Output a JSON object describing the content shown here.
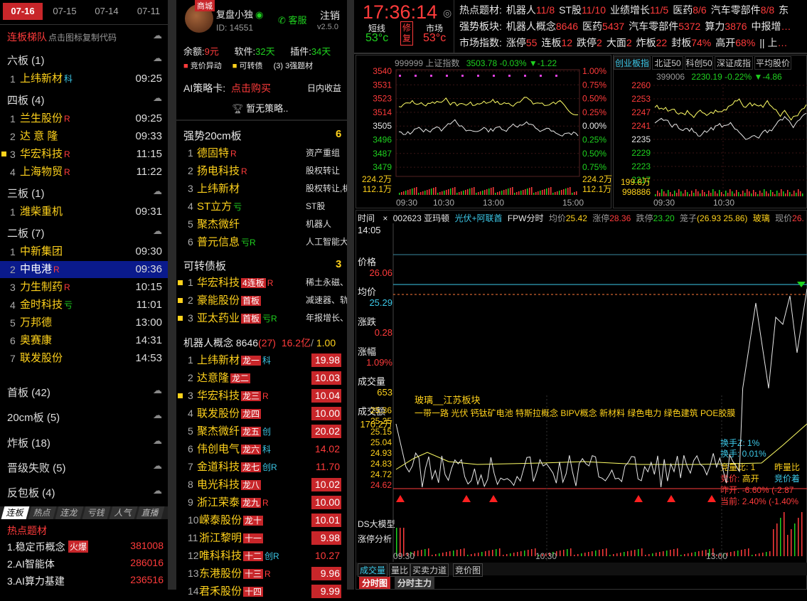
{
  "left": {
    "dates": [
      "07-16",
      "07-15",
      "07-14",
      "07-11"
    ],
    "header": {
      "title": "连板梯队",
      "hint": "点击图标复制代码"
    },
    "groups": [
      {
        "label": "六板  (1)",
        "rows": [
          {
            "n": "1",
            "name": "上纬新材",
            "tag": "科",
            "tagc": "cyan",
            "time": "09:25"
          }
        ]
      },
      {
        "label": "四板  (4)",
        "rows": [
          {
            "n": "1",
            "name": "兰生股份",
            "tag": "R",
            "tagc": "red",
            "time": "09:25"
          },
          {
            "n": "2",
            "name": "达 意 隆",
            "tag": "",
            "tagc": "",
            "time": "09:33"
          },
          {
            "n": "3",
            "name": "华宏科技",
            "tag": "R",
            "tagc": "red",
            "time": "11:15",
            "mark": true
          },
          {
            "n": "4",
            "name": "上海物贸",
            "tag": "R",
            "tagc": "red",
            "time": "11:22"
          }
        ]
      },
      {
        "label": "三板  (1)",
        "rows": [
          {
            "n": "1",
            "name": "潍柴重机",
            "tag": "",
            "tagc": "",
            "time": "09:31"
          }
        ]
      },
      {
        "label": "二板  (7)",
        "rows": [
          {
            "n": "1",
            "name": "中新集团",
            "tag": "",
            "tagc": "",
            "time": "09:30"
          },
          {
            "n": "2",
            "name": "中电港",
            "tag": "R",
            "tagc": "red",
            "time": "09:36",
            "sel": true
          },
          {
            "n": "3",
            "name": "力生制药",
            "tag": "R",
            "tagc": "red",
            "time": "10:15"
          },
          {
            "n": "4",
            "name": "金时科技",
            "tag": "亏",
            "tagc": "grn",
            "time": "11:01"
          },
          {
            "n": "5",
            "name": "万邦德",
            "tag": "",
            "tagc": "",
            "time": "13:00"
          },
          {
            "n": "6",
            "name": "奥赛康",
            "tag": "",
            "tagc": "",
            "time": "14:31"
          },
          {
            "n": "7",
            "name": "联发股份",
            "tag": "",
            "tagc": "",
            "time": "14:53"
          }
        ]
      }
    ],
    "summary": [
      "首板  (42)",
      "20cm板  (5)",
      "炸板  (18)",
      "晋级失败  (5)",
      "反包板  (4)"
    ],
    "tabs": [
      "连板",
      "热点",
      "连龙",
      "亏钱",
      "人气",
      "直播"
    ],
    "hot": {
      "title": "热点题材",
      "items": [
        {
          "name": "1.稳定币概念",
          "badge": "火爆",
          "val": "381008"
        },
        {
          "name": "2.AI智能体",
          "badge": "",
          "val": "286016"
        },
        {
          "name": "3.AI算力基建",
          "badge": "",
          "val": "236516"
        }
      ]
    }
  },
  "mid": {
    "app": {
      "badge": "商城",
      "name": "复盘小独",
      "id": "ID: 14551",
      "service": "客服",
      "logout": "注销",
      "version": "v2.5.0"
    },
    "balance": {
      "label": "余额:",
      "val": "9元",
      "soft": "软件:",
      "soft_val": "32天",
      "plugin": "插件:",
      "plugin_val": "34天"
    },
    "legend": [
      "竞价异动",
      "可转债",
      "(3) 3强题材"
    ],
    "ai": {
      "label": "AI策略卡:",
      "buy": "点击购买",
      "rev": "日内收益",
      "none": "暂无策略.."
    },
    "strong": {
      "title": "强势20cm板",
      "count": "6",
      "rows": [
        {
          "n": "1",
          "name": "德固特",
          "tag": "R",
          "tagc": "red",
          "desc": "资产重组"
        },
        {
          "n": "2",
          "name": "扬电科技",
          "tag": "R",
          "tagc": "red",
          "desc": "股权转让"
        },
        {
          "n": "3",
          "name": "上纬新材",
          "tag": "",
          "tagc": "",
          "desc": "股权转让,机"
        },
        {
          "n": "4",
          "name": "ST立方",
          "tag": "亏",
          "tagc": "grn",
          "desc": "ST股"
        },
        {
          "n": "5",
          "name": "聚杰微纤",
          "tag": "",
          "tagc": "",
          "desc": "机器人"
        },
        {
          "n": "6",
          "name": "普元信息",
          "tag": "亏R",
          "tagc": "grn",
          "desc": "人工智能大"
        }
      ]
    },
    "bond": {
      "title": "可转债板",
      "count": "3",
      "rows": [
        {
          "n": "1",
          "name": "华宏科技",
          "badge": "4连板",
          "tag": "R",
          "tagc": "red",
          "desc": "稀土永磁、"
        },
        {
          "n": "2",
          "name": "豪能股份",
          "badge": "首板",
          "tag": "",
          "tagc": "",
          "desc": "减速器、轨"
        },
        {
          "n": "3",
          "name": "亚太药业",
          "badge": "首板",
          "tag": "亏R",
          "tagc": "grn",
          "desc": "年报增长、"
        }
      ]
    },
    "concept": {
      "title": "机器人概念",
      "v1": "8646",
      "v2": "(27)",
      "v3": "16.2亿",
      "v4": "1.00",
      "rows": [
        {
          "n": "1",
          "name": "上纬新材",
          "badge": "龙一",
          "tag": "科",
          "tagc": "cyan",
          "pct": "19.98",
          "box": true
        },
        {
          "n": "2",
          "name": "达意隆",
          "badge": "龙二",
          "tag": "",
          "tagc": "",
          "pct": "10.03",
          "box": true
        },
        {
          "n": "3",
          "name": "华宏科技",
          "badge": "龙三",
          "tag": "R",
          "tagc": "red",
          "pct": "10.04",
          "box": true,
          "mark": true
        },
        {
          "n": "4",
          "name": "联发股份",
          "badge": "龙四",
          "tag": "",
          "tagc": "",
          "pct": "10.00",
          "box": true
        },
        {
          "n": "5",
          "name": "聚杰微纤",
          "badge": "龙五",
          "tag": "创",
          "tagc": "cyan",
          "pct": "20.02",
          "box": true
        },
        {
          "n": "6",
          "name": "伟创电气",
          "badge": "龙六",
          "tag": "科",
          "tagc": "cyan",
          "pct": "14.02",
          "box": false
        },
        {
          "n": "7",
          "name": "金道科技",
          "badge": "龙七",
          "tag": "创R",
          "tagc": "cyan",
          "pct": "11.70",
          "box": false
        },
        {
          "n": "8",
          "name": "电光科技",
          "badge": "龙八",
          "tag": "",
          "tagc": "",
          "pct": "10.02",
          "box": true
        },
        {
          "n": "9",
          "name": "浙江荣泰",
          "badge": "龙九",
          "tag": "R",
          "tagc": "red",
          "pct": "10.00",
          "box": true
        },
        {
          "n": "10",
          "name": "嵘泰股份",
          "badge": "龙十",
          "tag": "",
          "tagc": "",
          "pct": "10.01",
          "box": true
        },
        {
          "n": "11",
          "name": "浙江黎明",
          "badge": "十一",
          "tag": "",
          "tagc": "",
          "pct": "9.98",
          "box": true
        },
        {
          "n": "12",
          "name": "唯科科技",
          "badge": "十二",
          "tag": "创R",
          "tagc": "cyan",
          "pct": "10.27",
          "box": false
        },
        {
          "n": "13",
          "name": "东港股份",
          "badge": "十三",
          "tag": "R",
          "tagc": "red",
          "pct": "9.96",
          "box": true
        },
        {
          "n": "14",
          "name": "君禾股份",
          "badge": "十四",
          "tag": "",
          "tagc": "",
          "pct": "9.99",
          "box": true
        }
      ]
    }
  },
  "right": {
    "clock": "17:36:14",
    "short": "短线",
    "short_t": "53°c",
    "rep": "修复",
    "market": "市场",
    "market_t": "53°c",
    "info": [
      {
        "label": "热点题材:",
        "items": [
          [
            "机器人",
            "11/8"
          ],
          [
            "ST股",
            "11/10"
          ],
          [
            "业绩增长",
            "11/5"
          ],
          [
            "医药",
            "8/6"
          ],
          [
            "汽车零部件",
            "8/8"
          ],
          [
            "东",
            ""
          ]
        ]
      },
      {
        "label": "强势板块:",
        "items": [
          [
            "机器人概念",
            "8646"
          ],
          [
            "医药",
            "5437"
          ],
          [
            "汽车零部件",
            "5372"
          ],
          [
            "算力",
            "3876"
          ],
          [
            "中报增",
            "…"
          ]
        ]
      },
      {
        "label": "市场指数:",
        "items": [
          [
            "涨停",
            "55"
          ],
          [
            "连板",
            "12"
          ],
          [
            "跌停",
            "2"
          ],
          [
            "大面",
            "2"
          ],
          [
            "炸板",
            "22"
          ],
          [
            "封板",
            "74%"
          ],
          [
            "高开",
            "68%"
          ],
          [
            "|| 上",
            "…"
          ]
        ]
      }
    ],
    "sh": {
      "code": "999999",
      "name": "上证指数",
      "price": "3503.78",
      "chg": "-0.03%",
      "d": "▼-1.22",
      "yl": [
        "3540",
        "3531",
        "3523",
        "3514",
        "3505",
        "3496",
        "3487",
        "3479"
      ],
      "pl": [
        "1.00%",
        "0.75%",
        "0.50%",
        "0.25%",
        "0.00%",
        "0.25%",
        "0.50%",
        "0.75%"
      ],
      "vol": [
        "224.2万",
        "112.1万"
      ],
      "vol_r": [
        "224.2万",
        "112.1万"
      ],
      "times": [
        "09:30",
        "10:30",
        "13:00",
        "15:00"
      ]
    },
    "cy": {
      "tabs": [
        "创业板指",
        "北证50",
        "科创50",
        "深证成指",
        "平均股价"
      ],
      "code": "399006",
      "price": "2230.19",
      "chg": "-0.22%",
      "d": "▼-4.86",
      "yl": [
        "2260",
        "2253",
        "2247",
        "2241",
        "2235",
        "2229",
        "2223",
        "2217"
      ],
      "vol": [
        "199.8万",
        "998886"
      ],
      "times": [
        "09:30",
        "10:30"
      ]
    },
    "stock": {
      "time": "时间",
      "code": "002623",
      "name": "亚玛顿",
      "concept": "光伏+阿联酋",
      "fpw": "FPW分时",
      "avg": "均价",
      "avg_v": "25.42",
      "zt": "涨停",
      "zt_v": "28.36",
      "dt": "跌停",
      "dt_v": "23.20",
      "cage": "笼子",
      "cage_v": "(26.93 25.86)",
      "glass": "玻璃",
      "now": "现价",
      "now_v": "26.",
      "side": [
        [
          "14:05",
          ""
        ],
        [
          "价格",
          "26.06"
        ],
        [
          "均价",
          "25.29"
        ],
        [
          "涨跌",
          "0.28"
        ],
        [
          "涨幅",
          "1.09%"
        ],
        [
          "成交量",
          "653"
        ],
        [
          "成交额",
          "170.2万"
        ]
      ],
      "yl": [
        "25.36",
        "25.25",
        "25.15",
        "25.04",
        "24.93",
        "24.83",
        "24.72",
        "24.62"
      ],
      "title": "玻璃__江苏板块",
      "concepts": "一带一路 光伏 钙钛矿电池 特斯拉概念 BIPV概念 新材料 绿色电力 绿色建筑 POE胶膜",
      "hsz": "换手Z: 1%",
      "hs": "换手: 0.01%",
      "jjl": "竞量比: 1",
      "zlb": "昨量比",
      "jj": "竞价:",
      "gk": "高开",
      "jjg": "竞价着",
      "zk": "昨开:",
      "zk_v": "-6.60%",
      "zk2": "(-2.87",
      "dq": "当前:",
      "dq_v": "2.40%",
      "dq2": "(-1.40%",
      "bottom": [
        "DS大模型",
        "涨停分析"
      ],
      "times": [
        "09:30",
        "10:30",
        "13:00"
      ],
      "tabs": [
        "成交量",
        "量比",
        "买卖力道",
        "竞价图"
      ],
      "tabs2": [
        "分时图",
        "分时主力"
      ]
    }
  }
}
